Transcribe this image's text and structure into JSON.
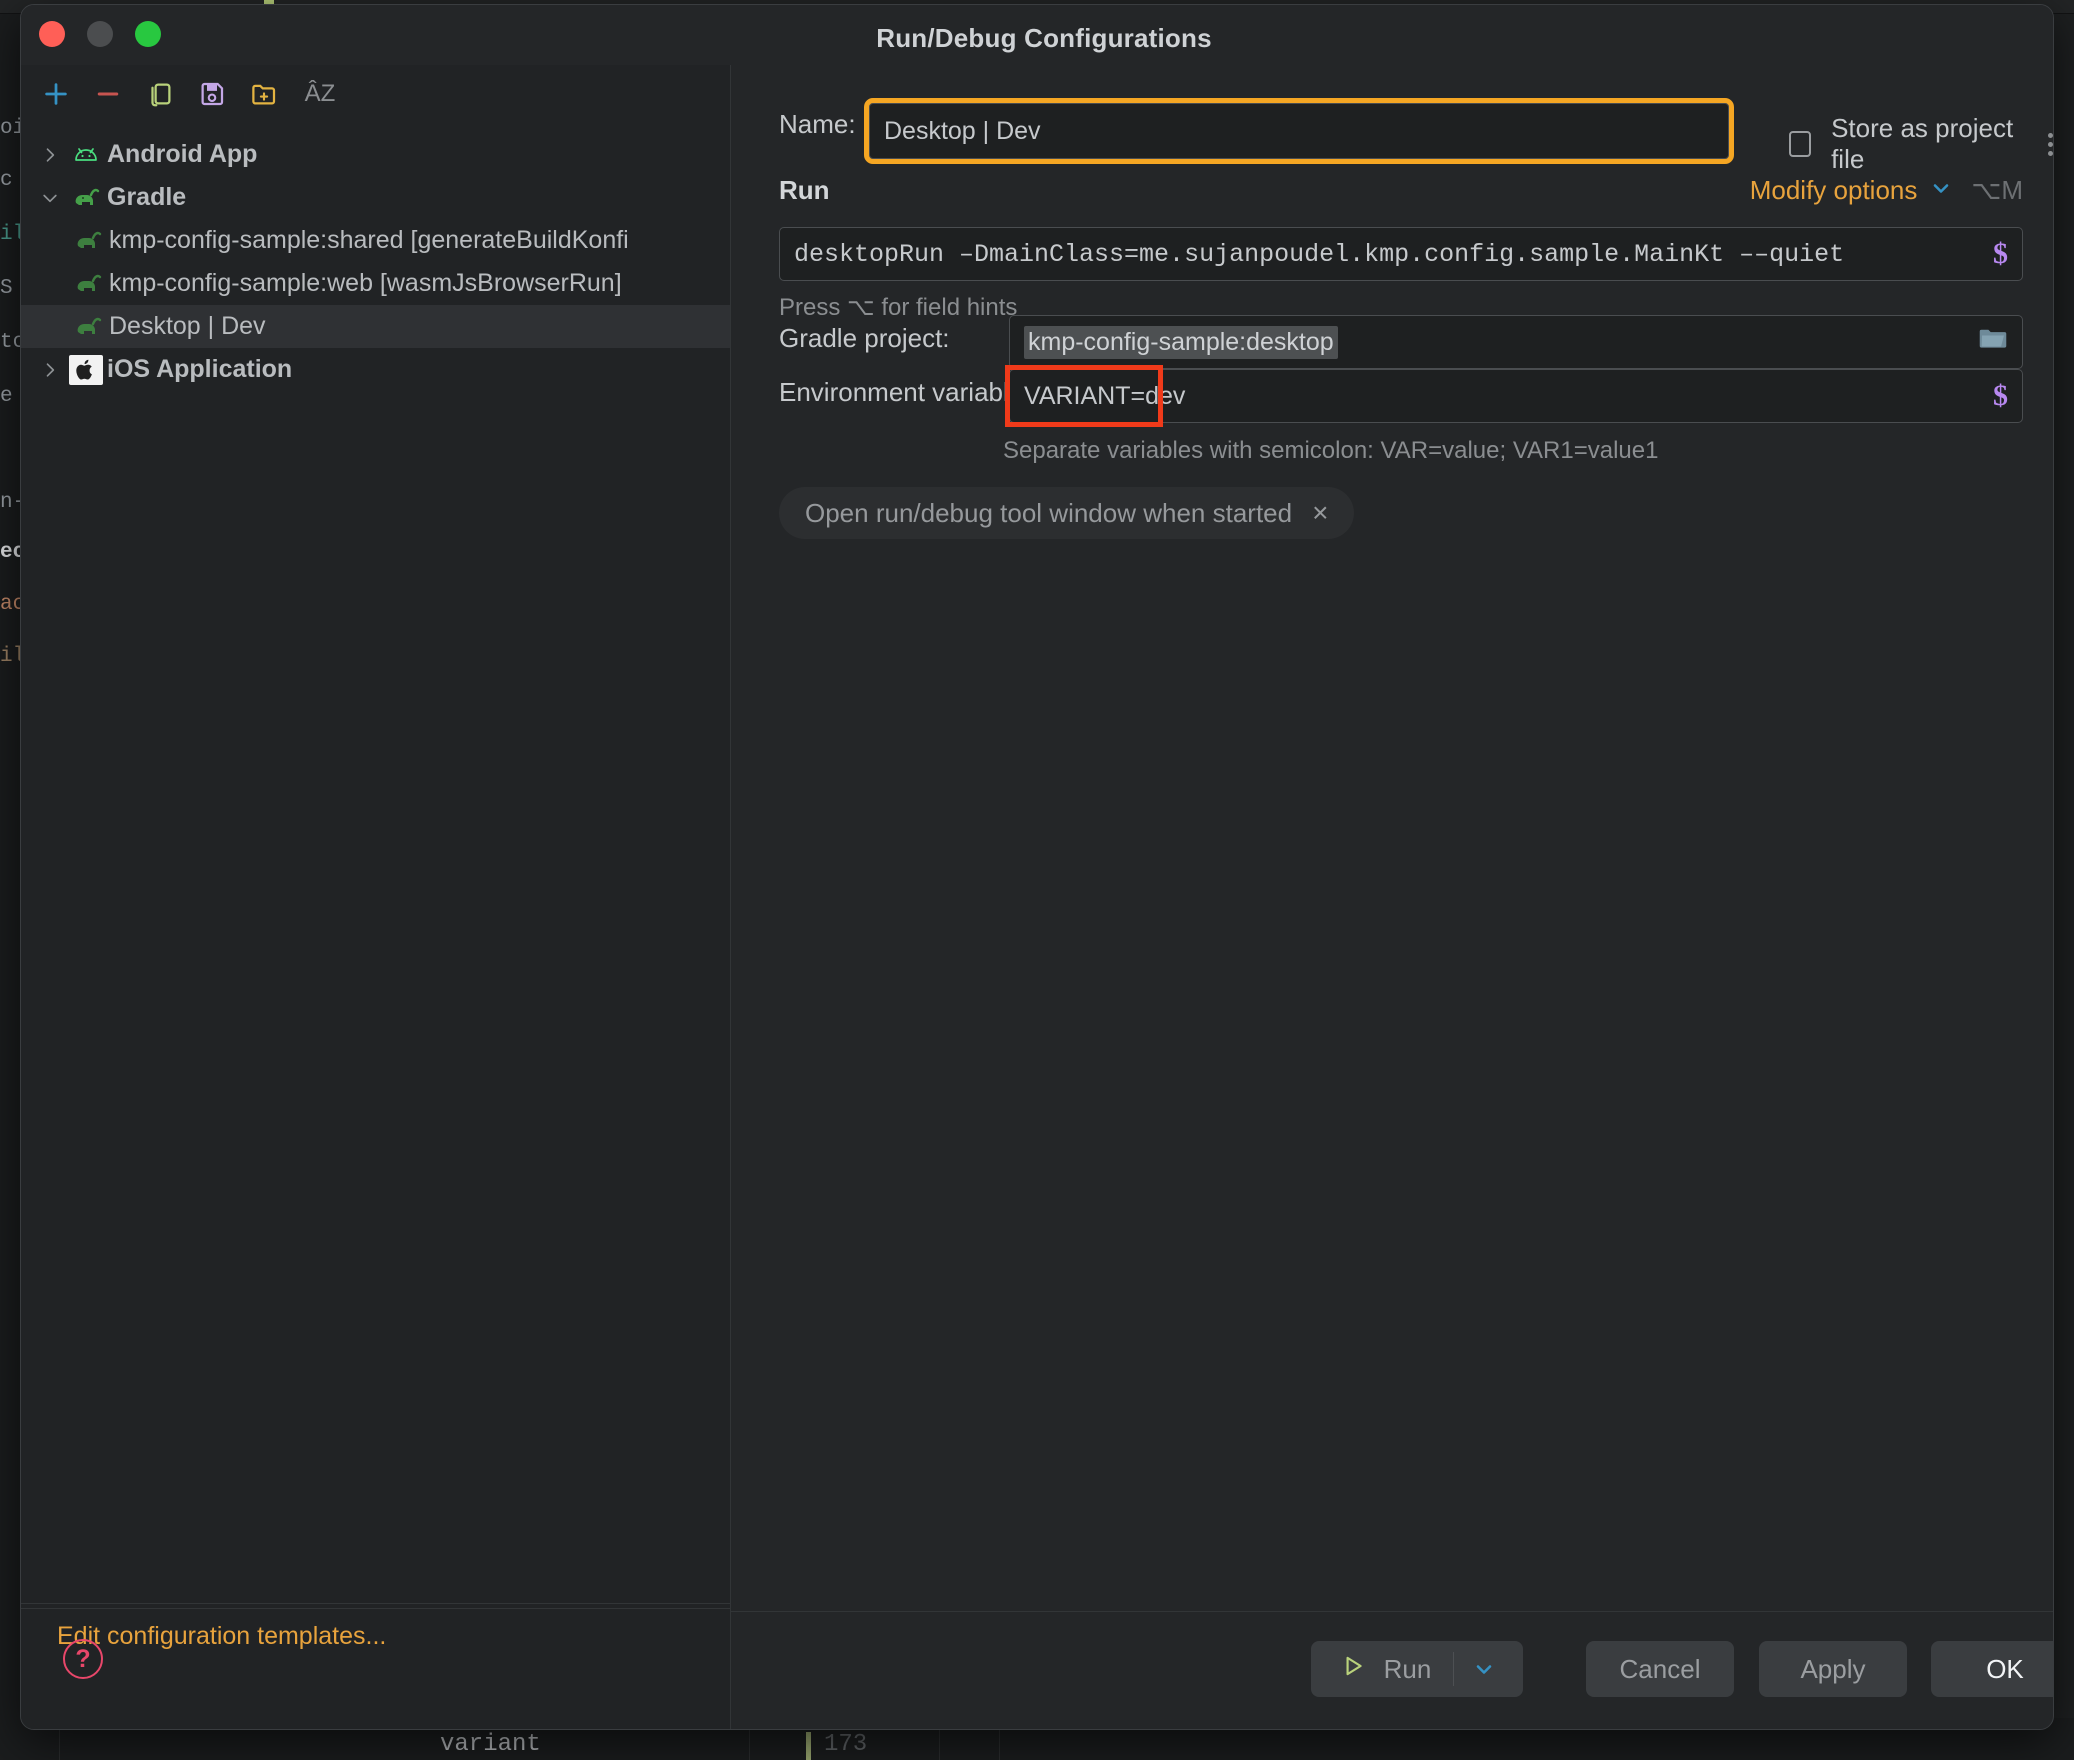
{
  "background": {
    "bottom_code": "variant",
    "bottom_line_number": "173",
    "code_fragments": [
      "oi",
      "c",
      "ilc",
      "S",
      "tc",
      "e",
      "n-j",
      "ec",
      "ac",
      "ilc"
    ]
  },
  "window": {
    "title": "Run/Debug Configurations",
    "traffic_lights": [
      "close",
      "minimize",
      "zoom"
    ]
  },
  "left_panel": {
    "toolbar": [
      {
        "name": "add-configuration-button",
        "icon": "plus-icon",
        "glyph": "+",
        "color": "#3592c4"
      },
      {
        "name": "remove-configuration-button",
        "icon": "minus-icon",
        "glyph": "–",
        "color": "#c75450"
      },
      {
        "name": "copy-configuration-button",
        "icon": "copy-icon",
        "glyph": "⧉",
        "color": "#b9d27b"
      },
      {
        "name": "save-configuration-button",
        "icon": "save-icon",
        "glyph": "💾",
        "color": "#c4a7e7"
      },
      {
        "name": "move-to-folder-button",
        "icon": "folder-add-icon",
        "glyph": "📁",
        "color": "#e3b341"
      },
      {
        "name": "sort-configurations-button",
        "icon": "sort-alphabetically-icon",
        "glyph": "ÂZ",
        "color": "#8b8e91"
      }
    ],
    "tree": [
      {
        "label": "Android App",
        "icon": "android-icon",
        "expanded": false,
        "level": 0,
        "selected": false,
        "bold": true,
        "chevron": "›"
      },
      {
        "label": "Gradle",
        "icon": "gradle-elephant-icon",
        "expanded": true,
        "level": 0,
        "selected": false,
        "bold": true,
        "chevron": "⌄"
      },
      {
        "label": "kmp-config-sample:shared [generateBuildKonfi",
        "icon": "gradle-elephant-icon",
        "level": 1,
        "selected": false,
        "bold": false
      },
      {
        "label": "kmp-config-sample:web [wasmJsBrowserRun]",
        "icon": "gradle-elephant-icon",
        "level": 1,
        "selected": false,
        "bold": false
      },
      {
        "label": "Desktop | Dev",
        "icon": "gradle-elephant-icon",
        "level": 1,
        "selected": true,
        "bold": false
      },
      {
        "label": "iOS Application",
        "icon": "apple-icon",
        "expanded": false,
        "level": 0,
        "selected": false,
        "bold": true,
        "chevron": "›"
      }
    ],
    "edit_templates_link": "Edit configuration templates..."
  },
  "form": {
    "name_label": "Name:",
    "name_value": "Desktop | Dev",
    "store_as_project_file_label": "Store as project file",
    "store_as_project_file_checked": false,
    "run_section_title": "Run",
    "modify_options_label": "Modify options",
    "modify_options_shortcut": "⌥M",
    "command_value": "desktopRun –DmainClass=me.sujanpoudel.kmp.config.sample.MainKt ––quiet",
    "field_hint": "Press ⌥ for field hints",
    "gradle_project_label": "Gradle project:",
    "gradle_project_value": "kmp-config-sample:desktop",
    "env_vars_label": "Environment variables:",
    "env_vars_value": "VARIANT=dev",
    "env_vars_hint": "Separate variables with semicolon: VAR=value; VAR1=value1",
    "chip_label": "Open run/debug tool window when started",
    "chip_close": "×",
    "macro_glyph": "$"
  },
  "footer": {
    "help_glyph": "?",
    "run_label": "Run",
    "run_arrow": "⌄",
    "cancel_label": "Cancel",
    "apply_label": "Apply",
    "ok_label": "OK"
  },
  "colors": {
    "accent_orange": "#e8a33d",
    "annotation_orange": "#f5a623",
    "annotation_red": "#f03a1a",
    "macro_purple": "#b888f0",
    "help_pink": "#e8476a",
    "blue": "#3592c4"
  }
}
